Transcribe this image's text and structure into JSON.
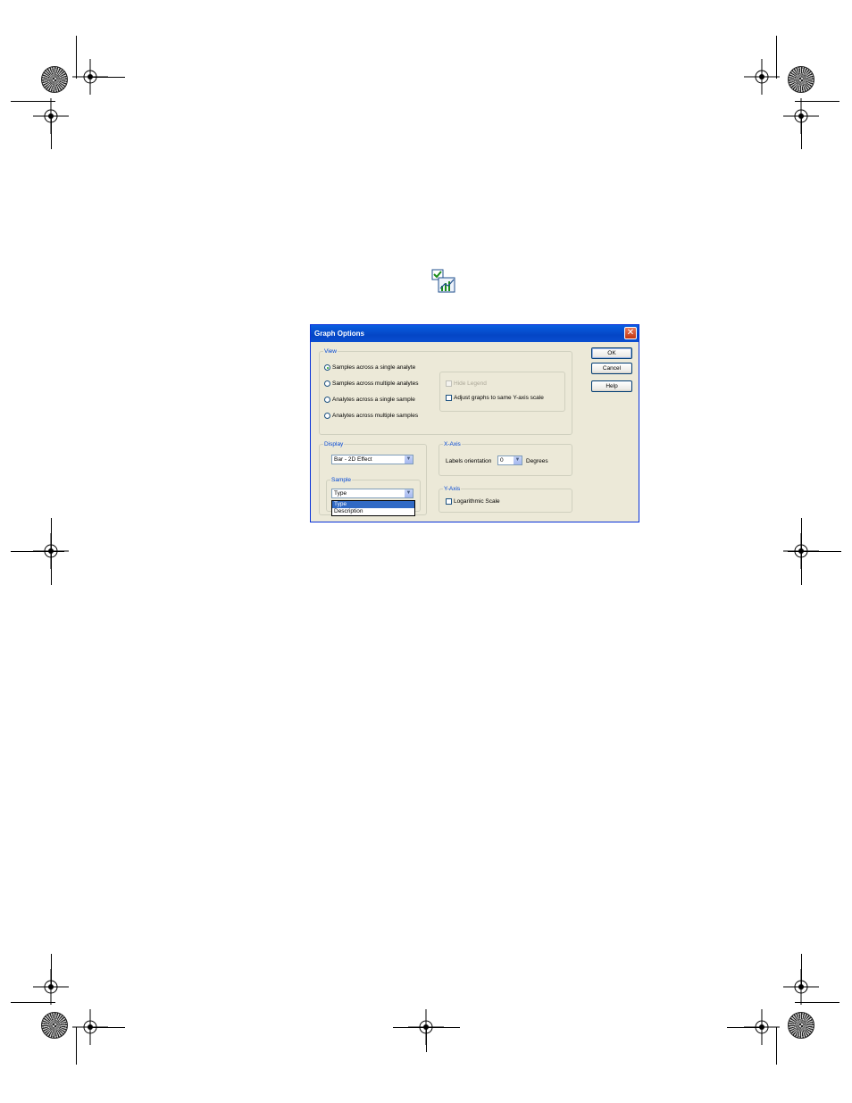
{
  "dialog": {
    "title": "Graph Options",
    "close_glyph": "✕",
    "view": {
      "legend": "View",
      "options": [
        {
          "label": "Samples across a single analyte",
          "selected": true
        },
        {
          "label": "Samples across multiple analytes",
          "selected": false
        },
        {
          "label": "Analytes across a single sample",
          "selected": false
        },
        {
          "label": "Analytes across multiple samples",
          "selected": false
        }
      ],
      "hide_legend": {
        "label": "Hide Legend",
        "checked": false,
        "disabled": true
      },
      "adjust_graphs": {
        "label": "Adjust graphs to same Y-axis scale",
        "checked": false
      }
    },
    "display": {
      "legend": "Display",
      "type_value": "Bar - 2D Effect",
      "sample": {
        "legend": "Sample",
        "value": "Type",
        "options": [
          "Type",
          "Description"
        ],
        "highlighted": "Type"
      }
    },
    "x_axis": {
      "legend": "X-Axis",
      "orientation_label": "Labels orientation",
      "orientation_value": "0",
      "unit": "Degrees"
    },
    "y_axis": {
      "legend": "Y-Axis",
      "log_scale": {
        "label": "Logarithmic Scale",
        "checked": false
      }
    },
    "buttons": {
      "ok": "OK",
      "cancel": "Cancel",
      "help": "Help"
    }
  },
  "icons": {
    "toolbar": "graph-options-icon",
    "dropdown": "chevron-down-icon"
  },
  "colors": {
    "titlebar": "#0445c5",
    "dialog_bg": "#ece9d8",
    "group_legend": "#0046d5",
    "selection": "#316ac5"
  }
}
